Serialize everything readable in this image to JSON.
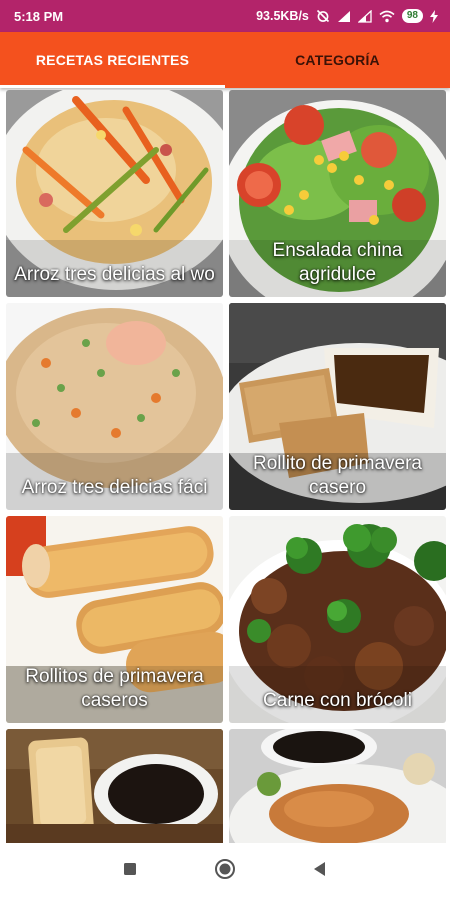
{
  "status_bar": {
    "time": "5:18 PM",
    "network_speed": "93.5KB/s",
    "battery": "98"
  },
  "tabs": [
    {
      "label": "RECETAS RECIENTES",
      "active": true
    },
    {
      "label": "CATEGORÍA",
      "active": false
    }
  ],
  "recipes": [
    {
      "title": "Arroz tres delicias al wo"
    },
    {
      "title": "Ensalada china agridulce"
    },
    {
      "title": "Arroz tres delicias fáci"
    },
    {
      "title": "Rollito de primavera casero"
    },
    {
      "title": "Rollitos de primavera caseros"
    },
    {
      "title": "Carne con brócoli"
    },
    {
      "title": ""
    },
    {
      "title": ""
    }
  ],
  "colors": {
    "status_bar": "#b3246a",
    "tab_bar": "#f4511e"
  },
  "icons": {
    "nav": [
      "recent-apps-icon",
      "home-icon",
      "back-icon"
    ]
  }
}
